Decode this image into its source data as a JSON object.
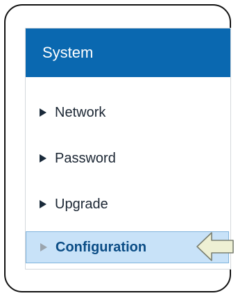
{
  "panel": {
    "title": "System"
  },
  "menu": {
    "items": [
      {
        "label": "Network",
        "active": false
      },
      {
        "label": "Password",
        "active": false
      },
      {
        "label": "Upgrade",
        "active": false
      },
      {
        "label": "Configuration",
        "active": true
      }
    ]
  },
  "colors": {
    "header_background": "#0a68b0",
    "active_background": "#c8e2f8",
    "active_text": "#0a4c85",
    "pointer_fill": "#eef0d4"
  },
  "icons": {
    "menu_bullet": "triangle-right-icon",
    "callout": "left-arrow-icon"
  }
}
